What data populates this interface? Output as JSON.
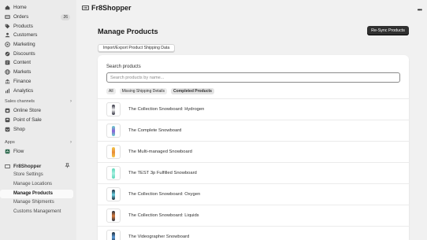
{
  "sidebar": {
    "main_items": [
      {
        "label": "Home",
        "icon": "home-icon"
      },
      {
        "label": "Orders",
        "icon": "orders-icon",
        "badge": "26"
      },
      {
        "label": "Products",
        "icon": "tag-icon"
      },
      {
        "label": "Customers",
        "icon": "person-icon"
      },
      {
        "label": "Marketing",
        "icon": "target-icon"
      },
      {
        "label": "Discounts",
        "icon": "discount-icon"
      },
      {
        "label": "Content",
        "icon": "content-icon"
      },
      {
        "label": "Markets",
        "icon": "globe-icon"
      },
      {
        "label": "Finance",
        "icon": "bank-icon"
      },
      {
        "label": "Analytics",
        "icon": "chart-icon"
      }
    ],
    "sales_channels_title": "Sales channels",
    "sales_channels": [
      {
        "label": "Online Store",
        "icon": "store-icon"
      },
      {
        "label": "Point of Sale",
        "icon": "pos-icon"
      },
      {
        "label": "Shop",
        "icon": "shop-icon"
      }
    ],
    "apps_title": "Apps",
    "apps": [
      {
        "label": "Flow",
        "icon": "flow-icon"
      }
    ],
    "app_name": "Fr8Shopper",
    "app_sub_items": [
      {
        "label": "Store Settings",
        "active": false
      },
      {
        "label": "Manage Locations",
        "active": false
      },
      {
        "label": "Manage Products",
        "active": true
      },
      {
        "label": "Manage Shipments",
        "active": false
      },
      {
        "label": "Customs Management",
        "active": false
      }
    ]
  },
  "header": {
    "logo_text": "FRI",
    "title": "Fr8Shopper"
  },
  "page": {
    "title": "Manage Products",
    "resync_label": "Re-Sync Products",
    "import_label": "Import/Export Product Shipping Data"
  },
  "search": {
    "label": "Search products",
    "placeholder": "Search products by name..."
  },
  "filters": [
    {
      "label": "All",
      "selected": false
    },
    {
      "label": "Missing Shipping Details",
      "selected": false
    },
    {
      "label": "Completed Products",
      "selected": true
    }
  ],
  "products": [
    {
      "name": "The Collection Snowboard: Hydrogen",
      "color": "#2b2b3a",
      "accent": "#f2f2f2"
    },
    {
      "name": "The Complete Snowboard",
      "color": "#6ad1c9",
      "accent": "#8a62d8"
    },
    {
      "name": "The Multi-managed Snowboard",
      "color": "#f3c84a",
      "accent": "#e88b3a"
    },
    {
      "name": "The TEST 3p Fulfilled Snowboard",
      "color": "#5ad6b8",
      "accent": "#a7efe0"
    },
    {
      "name": "The Collection Snowboard: Oxygen",
      "color": "#1f2b3a",
      "accent": "#6ad1e3"
    },
    {
      "name": "The Collection Snowboard: Liquids",
      "color": "#2a3340",
      "accent": "#d77a3a"
    },
    {
      "name": "The Videographer Snowboard",
      "color": "#1e2a36",
      "accent": "#5a9ad8"
    }
  ]
}
